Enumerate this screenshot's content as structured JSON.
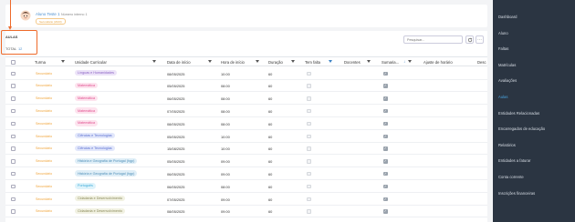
{
  "student": {
    "name": "Aluno Teste 1",
    "number": "Número interno 1",
    "badge": "Secundário (2023)"
  },
  "section": {
    "title": "AULAS",
    "total_label": "TOTAL",
    "total_value": "12"
  },
  "toolbar": {
    "search_placeholder": "Pesquisar..."
  },
  "columns": [
    "Turma",
    "Unidade Curricular",
    "Data de início",
    "Hora de início",
    "Duração",
    "Tem falta",
    "Docentes",
    "Sumaria...",
    "Ajuste de horário",
    "Desc"
  ],
  "rows": [
    {
      "turma": "Secundário",
      "uc": "Línguas e Humanidades",
      "uc_color": "#8a62c4",
      "uc_bg": "#ece3f8",
      "data": "08/05/2025",
      "hora": "10:00",
      "duracao": "60"
    },
    {
      "turma": "Secundário",
      "uc": "Matemática",
      "uc_color": "#e04f8f",
      "uc_bg": "#fde3ee",
      "data": "05/05/2025",
      "hora": "08:00",
      "duracao": "60"
    },
    {
      "turma": "Secundário",
      "uc": "Matemática",
      "uc_color": "#e04f8f",
      "uc_bg": "#fde3ee",
      "data": "06/05/2025",
      "hora": "08:00",
      "duracao": "60"
    },
    {
      "turma": "Secundário",
      "uc": "Matemática",
      "uc_color": "#e04f8f",
      "uc_bg": "#fde3ee",
      "data": "07/05/2025",
      "hora": "08:00",
      "duracao": "60"
    },
    {
      "turma": "Secundário",
      "uc": "Matemática",
      "uc_color": "#e04f8f",
      "uc_bg": "#fde3ee",
      "data": "08/05/2025",
      "hora": "08:00",
      "duracao": "60"
    },
    {
      "turma": "Secundário",
      "uc": "Ciências e Tecnologias",
      "uc_color": "#5a6fd0",
      "uc_bg": "#e2e7fb",
      "data": "05/05/2025",
      "hora": "10:00",
      "duracao": "60"
    },
    {
      "turma": "Secundário",
      "uc": "Ciências e Tecnologias",
      "uc_color": "#5a6fd0",
      "uc_bg": "#e2e7fb",
      "data": "15/08/2025",
      "hora": "10:00",
      "duracao": "60"
    },
    {
      "turma": "Secundário",
      "uc": "História e Geografia de Portugal (hgp)",
      "uc_color": "#4f8fb8",
      "uc_bg": "#dfeef7",
      "data": "05/05/2025",
      "hora": "09:00",
      "duracao": "60"
    },
    {
      "turma": "Secundário",
      "uc": "História e Geografia de Portugal (hgp)",
      "uc_color": "#4f8fb8",
      "uc_bg": "#dfeef7",
      "data": "06/05/2025",
      "hora": "09:00",
      "duracao": "60"
    },
    {
      "turma": "Secundário",
      "uc": "Português",
      "uc_color": "#3aa9d8",
      "uc_bg": "#def3fb",
      "data": "06/05/2025",
      "hora": "08:00",
      "duracao": "60"
    },
    {
      "turma": "Secundário",
      "uc": "Cidadania e Desenvolvimento",
      "uc_color": "#8a8a5a",
      "uc_bg": "#f1f1e2",
      "data": "07/05/2025",
      "hora": "09:00",
      "duracao": "60"
    },
    {
      "turma": "Secundário",
      "uc": "Cidadania e Desenvolvimento",
      "uc_color": "#8a8a5a",
      "uc_bg": "#f1f1e2",
      "data": "08/05/2025",
      "hora": "09:00",
      "duracao": "60"
    }
  ],
  "sidebar": {
    "items": [
      "Dashboard",
      "Aluno",
      "Faltas",
      "Matrículas",
      "Avaliações",
      "Aulas",
      "Entidades Relacionadas",
      "Encarregados de educação",
      "Relatórios",
      "Entidades a faturar",
      "Conta corrente",
      "Inscrições financeiras"
    ],
    "active_index": 5
  },
  "colors": {
    "accent": "#4aa3df",
    "highlight": "#ee6a2a",
    "turma_tag": "#f0a43a",
    "sidebar_bg": "#2b3542"
  }
}
